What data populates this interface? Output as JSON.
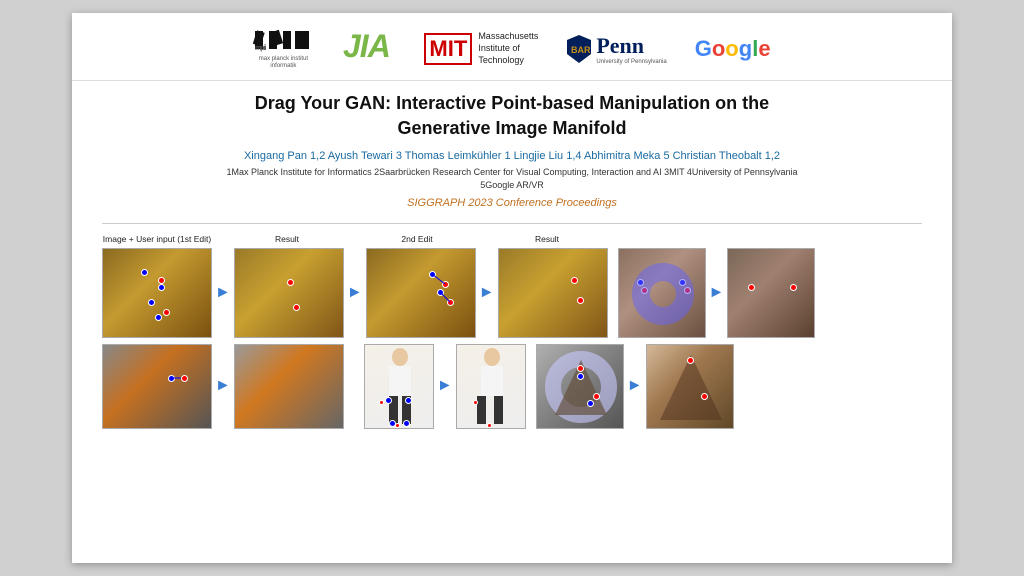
{
  "logos": {
    "mpi_top": "mpii",
    "mpi_sub1": "max planck institut",
    "mpi_sub2": "informatik",
    "jia": "JIA",
    "mit_text": "MIT",
    "mit_label1": "Massachusetts",
    "mit_label2": "Institute of",
    "mit_label3": "Technology",
    "penn_text": "Penn",
    "penn_sub": "University of Pennsylvania",
    "google": "Google"
  },
  "paper": {
    "title_line1": "Drag Your GAN: Interactive Point-based Manipulation on the",
    "title_line2": "Generative Image Manifold",
    "authors": "Xingang Pan 1,2   Ayush Tewari 3   Thomas Leimkühler 1   Lingjie Liu 1,4   Abhimitra Meka 5   Christian Theobalt 1,2",
    "affiliations_line1": "1Max Planck Institute for Informatics   2Saarbrücken Research Center for Visual Computing, Interaction and AI   3MIT   4University of Pennsylvania",
    "affiliations_line2": "5Google AR/VR",
    "conference": "SIGGRAPH 2023 Conference Proceedings"
  },
  "figure": {
    "col_label1": "Image + User input (1st Edit)",
    "col_label2": "Result",
    "col_label3": "2nd Edit",
    "col_label4": "Result"
  }
}
